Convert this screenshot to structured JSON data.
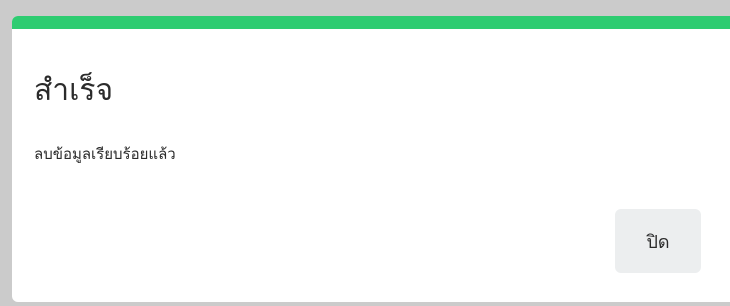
{
  "modal": {
    "title": "สำเร็จ",
    "message": "ลบข้อมูลเรียบร้อยแล้ว",
    "close_label": "ปิด",
    "accent_color": "#2ecc71",
    "status": "success"
  }
}
